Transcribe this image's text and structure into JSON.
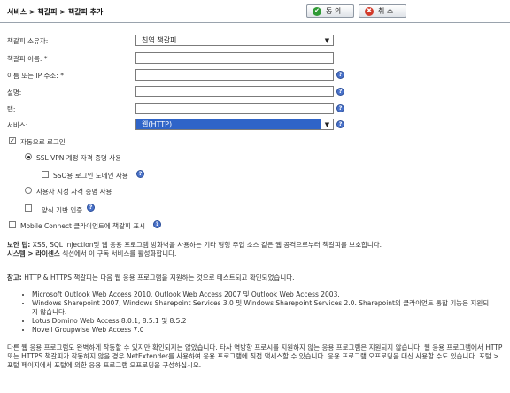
{
  "header": {
    "breadcrumb": "서비스 > 책갈피 > 책갈피 추가",
    "ok_label": "동 의",
    "cancel_label": "취 소",
    "ok_icon": "checkmark-icon",
    "cancel_icon": "x-icon",
    "ok_color": "#2f9a35",
    "cancel_color": "#d23a2a"
  },
  "form": {
    "owner_label": "책갈피 소유자:",
    "owner_value": "친역 책갈피",
    "name_label": "책갈피 이름: *",
    "name_value": "",
    "host_label": "이름 또는 IP 주소: *",
    "host_value": "",
    "desc_label": "설명:",
    "desc_value": "",
    "tab_label": "탭:",
    "tab_value": "",
    "service_label": "서비스:",
    "service_value": "웹(HTTP)",
    "highlight_color": "#2f64c8"
  },
  "options": {
    "auto_login": "자동으로 로그인",
    "auto_login_checked": true,
    "sslvpn_creds": "SSL VPN 계정 자격 증명 사용",
    "sslvpn_selected": true,
    "sso_domain": "SSO용 로그인 도메인 사용",
    "custom_creds": "사용자 지정 자격 증명 사용",
    "form_auth": "양식 기반 인증",
    "mobile_connect": "Mobile Connect 클라이언트에 책갈피 표시"
  },
  "notes": {
    "security_bold": "보안 팁:",
    "security_text": " XSS, SQL Injection및 웹 응용 프로그램 방화벽을 사용하는 기타 형행 주입 소스 같은 웹 공격으로부터 책갈피를 보호합니다.",
    "system_bold": "시스템 > 라이센스",
    "system_text": " 섹션에서 이 구독 서비스를 활성화합니다.",
    "ref_bold": "참고:",
    "ref_text": " HTTP & HTTPS 책갈피는 다음 웹 응용 프로그램을 지원하는 것으로 테스트되고 확인되었습니다.",
    "apps": [
      "Microsoft Outlook Web Access 2010, Outlook Web Access 2007 및 Outlook Web Access 2003.",
      "Windows Sharepoint 2007, Windows Sharepoint Services 3.0 및 Windows Sharepoint Services 2.0. Sharepoint의 클라이언트 통합 기능은 지원되지 않습니다.",
      "Lotus Domino Web Access 8.0.1, 8.5.1 및 8.5.2",
      "Novell Groupwise Web Access 7.0"
    ],
    "footer": "다른 웹 응용 프로그램도 완벽하게 작동할 수 있지만 확인되지는 않았습니다. 타사 역방향 프로시를 지원하지 않는 응용 프로그램은 지원되지 않습니다. 웹 응용 프로그램에서 HTTP 또는 HTTPS 책갈피가 작동하지 않을 경우 NetExtender를 사용하여 응용 프로그램에 직접 액세스할 수 있습니다. 응용 프로그램 오프로딩을 대신 사용할 수도 있습니다. 포털 > 포털 페이지에서 포털에 의한 응용 프로그램 오프로딩을 구성하십시오."
  },
  "icons": {
    "help": "help-icon"
  }
}
